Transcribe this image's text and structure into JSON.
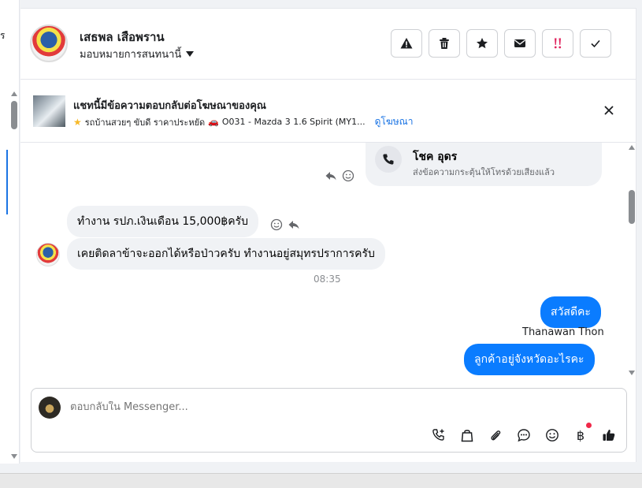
{
  "left": {
    "cut_text": "ร"
  },
  "header": {
    "contact_name": "เสธพล เสือพราน",
    "assign_label": "มอบหมายการสนทนานี้",
    "actions": [
      {
        "name": "report-spam-icon",
        "label": "warning"
      },
      {
        "name": "delete-icon",
        "label": "trash"
      },
      {
        "name": "star-icon",
        "label": "star"
      },
      {
        "name": "mark-unread-icon",
        "label": "envelope"
      },
      {
        "name": "follow-up-icon",
        "label": "follow-up"
      },
      {
        "name": "mark-done-icon",
        "label": "check"
      }
    ]
  },
  "ad": {
    "title": "แชทนี้มีข้อความตอบกลับต่อโฆษณาของคุณ",
    "subtitle": "รถบ้านสวยๆ ขับดี ราคาประหยัด",
    "ad_detail": "O031 - Mazda 3 1.6 Spirit (MY1...",
    "view_ad": "ดูโฆษณา"
  },
  "chat": {
    "call_card": {
      "title": "โชค อุดร",
      "subtitle": "ส่งข้อความกระตุ้นให้โทรด้วยเสียงแล้ว"
    },
    "messages": [
      {
        "dir": "in",
        "text": "ทำงาน รปภ.เงินเดือน 15,000฿ครับ"
      },
      {
        "dir": "in",
        "text": "เคยติดลาข้าจะออกได้หรือป่าวครับ ทำงานอยู่สมุทรปราการครับ"
      },
      {
        "dir": "out",
        "text": "สวัสดีคะ"
      },
      {
        "dir": "out",
        "text": "ลูกค้าอยู่จังหวัดอะไรคะ"
      }
    ],
    "timestamp": "08:35",
    "agent_name": "Thanawan Thon"
  },
  "composer": {
    "placeholder": "ตอบกลับใน Messenger..."
  },
  "colors": {
    "brand_blue": "#0a7cff",
    "link_blue": "#1b74e4",
    "follow_up_red": "#e0245e"
  }
}
